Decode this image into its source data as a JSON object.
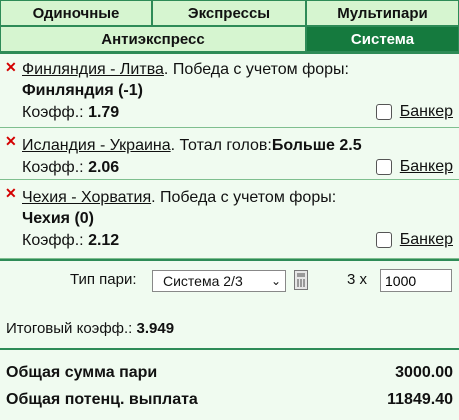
{
  "tabs": {
    "row1": [
      "Одиночные",
      "Экспрессы",
      "Мультипари"
    ],
    "row2": [
      "Антиэкспресс",
      "Система"
    ],
    "active": "Система"
  },
  "bets": [
    {
      "match": "Финляндия - Литва",
      "market": ". Победа с учетом форы:",
      "selection": "Финляндия (-1)",
      "coef_label": "Коэфф.:",
      "coef": "1.79",
      "banker_label": "Банкер"
    },
    {
      "match": "Исландия - Украина",
      "market": ". Тотал голов:",
      "selection": "Больше 2.5",
      "coef_label": "Коэфф.:",
      "coef": "2.06",
      "banker_label": "Банкер"
    },
    {
      "match": "Чехия - Хорватия",
      "market": ". Победа с учетом форы:",
      "selection": "Чехия (0)",
      "coef_label": "Коэфф.:",
      "coef": "2.12",
      "banker_label": "Банкер"
    }
  ],
  "system": {
    "type_label": "Тип пари:",
    "type_value": "Система 2/3",
    "multiplier": "3 x",
    "stake": "1000"
  },
  "total_coef": {
    "label": "Итоговый коэфф.:",
    "value": "3.949"
  },
  "sums": {
    "total_label": "Общая сумма пари",
    "total_value": "3000.00",
    "payout_label": "Общая потенц. выплата",
    "payout_value": "11849.40"
  },
  "colors": {
    "active_tab": "#157a3e",
    "tab_bg": "#d6f5d0",
    "page_bg": "#f0fbf0",
    "delete_icon": "#d40000"
  },
  "icons": {
    "delete": "close-icon",
    "calculator": "calculator-icon",
    "dropdown": "chevron-down-icon"
  }
}
